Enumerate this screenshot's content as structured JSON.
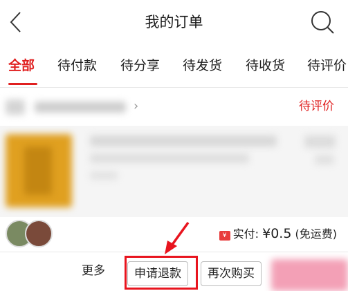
{
  "header": {
    "title": "我的订单",
    "back_icon": "chevron-left-icon",
    "search_icon": "search-icon"
  },
  "tabs": [
    {
      "label": "全部",
      "active": true
    },
    {
      "label": "待付款",
      "active": false
    },
    {
      "label": "待分享",
      "active": false
    },
    {
      "label": "待发货",
      "active": false
    },
    {
      "label": "待收货",
      "active": false
    },
    {
      "label": "待评价",
      "active": false
    }
  ],
  "order": {
    "status": "待评价",
    "paid_label": "实付: ",
    "paid_amount": "¥0.5",
    "shipping_note": " (免运费)"
  },
  "actions": {
    "more": "更多",
    "refund": "申请退款",
    "rebuy": "再次购买"
  },
  "colors": {
    "accent": "#e02020",
    "annotation": "#e8141e"
  }
}
